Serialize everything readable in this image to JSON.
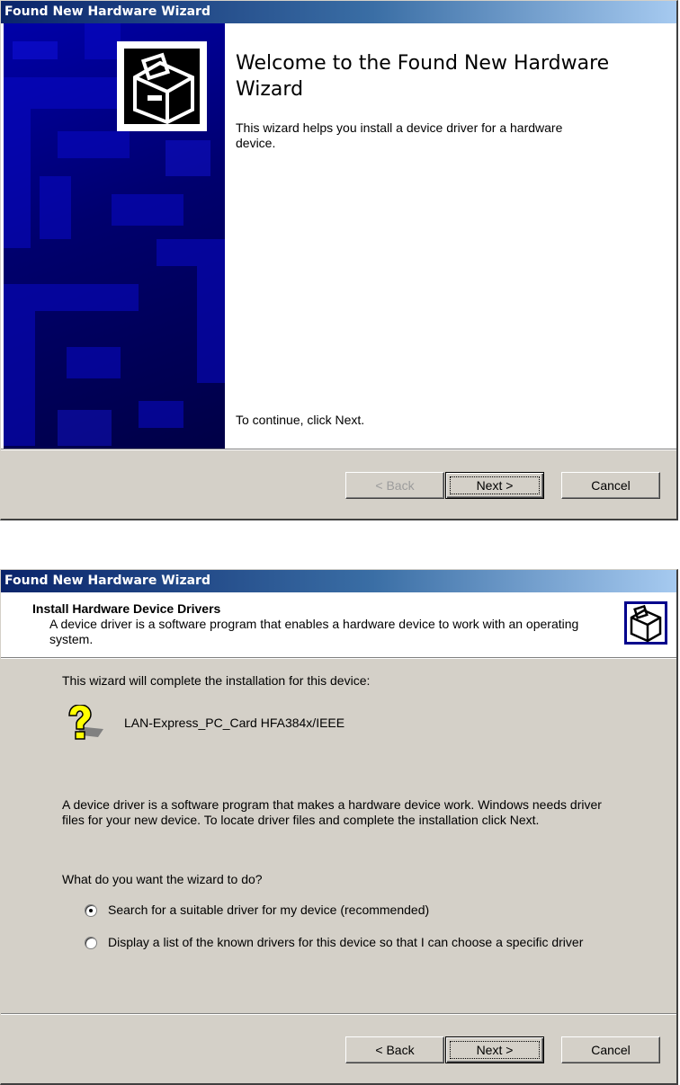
{
  "dialog1": {
    "title": "Found New Hardware Wizard",
    "heading": "Welcome to the Found New Hardware Wizard",
    "description": "This wizard helps you install a device driver for a hardware device.",
    "continue_text": "To continue, click Next.",
    "buttons": {
      "back": "< Back",
      "next": "Next >",
      "cancel": "Cancel"
    },
    "back_enabled": false
  },
  "dialog2": {
    "title": "Found New Hardware Wizard",
    "header_title": "Install Hardware Device Drivers",
    "header_desc": "A device driver is a software program that enables a hardware device to work with an operating system.",
    "intro": "This wizard will complete the installation for this device:",
    "device_name": "LAN-Express_PC_Card HFA384x/IEEE",
    "explanation": "A device driver is a software program that makes a hardware device work. Windows needs driver files for your new device. To locate driver files and complete the installation click Next.",
    "question": "What do you want the wizard to do?",
    "options": [
      {
        "label": "Search for a suitable driver for my device (recommended)",
        "checked": true
      },
      {
        "label": "Display a list of the known drivers for this device so that I can choose a specific driver",
        "checked": false
      }
    ],
    "buttons": {
      "back": "< Back",
      "next": "Next >",
      "cancel": "Cancel"
    }
  },
  "icons": {
    "wizard": "hardware-wizard-icon",
    "device": "unknown-device-icon",
    "sidebar": "hardware-watermark"
  },
  "colors": {
    "title_gradient_start": "#0a246a",
    "title_gradient_end": "#a6caf0",
    "sidebar_blue": "#00008c",
    "dialog_face": "#d4d0c8"
  }
}
